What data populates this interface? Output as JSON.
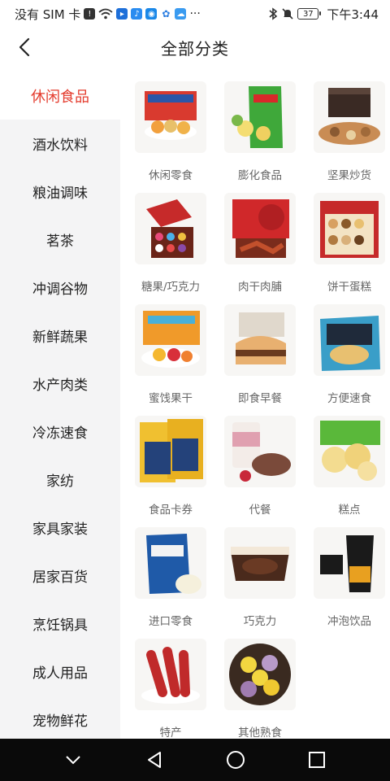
{
  "status_bar": {
    "carrier": "没有 SIM 卡",
    "battery": "37",
    "time": "下午3:44"
  },
  "header": {
    "title": "全部分类"
  },
  "sidebar": {
    "items": [
      {
        "label": "休闲食品"
      },
      {
        "label": "酒水饮料"
      },
      {
        "label": "粮油调味"
      },
      {
        "label": "茗茶"
      },
      {
        "label": "冲调谷物"
      },
      {
        "label": "新鲜蔬果"
      },
      {
        "label": "水产肉类"
      },
      {
        "label": "冷冻速食"
      },
      {
        "label": "家纺"
      },
      {
        "label": "家具家装"
      },
      {
        "label": "居家百货"
      },
      {
        "label": "烹饪锅具"
      },
      {
        "label": "成人用品"
      },
      {
        "label": "宠物鲜花"
      }
    ]
  },
  "categories": [
    {
      "label": "休闲零食"
    },
    {
      "label": "膨化食品"
    },
    {
      "label": "坚果炒货"
    },
    {
      "label": "糖果/巧克力"
    },
    {
      "label": "肉干肉脯"
    },
    {
      "label": "饼干蛋糕"
    },
    {
      "label": "蜜饯果干"
    },
    {
      "label": "即食早餐"
    },
    {
      "label": "方便速食"
    },
    {
      "label": "食品卡券"
    },
    {
      "label": "代餐"
    },
    {
      "label": "糕点"
    },
    {
      "label": "进口零食"
    },
    {
      "label": "巧克力"
    },
    {
      "label": "冲泡饮品"
    },
    {
      "label": "特产"
    },
    {
      "label": "其他熟食"
    }
  ],
  "colors": {
    "accent": "#e43c2e",
    "sidebar_bg": "#f4f4f5"
  }
}
